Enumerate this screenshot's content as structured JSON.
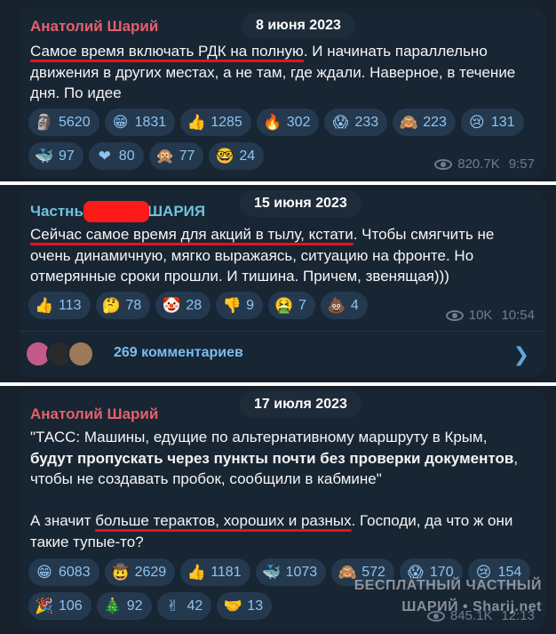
{
  "posts": [
    {
      "author": "Анатолий Шарий",
      "date": "8 июня 2023",
      "text_underlined": "Самое время включать РДК на полную",
      "text_rest": ". И начинать параллельно движения в других местах, а не там, где ждали. Наверное, в течение дня. По идее",
      "reactions": [
        {
          "icon": "moai-icon",
          "glyph": "🗿",
          "count": "5620"
        },
        {
          "icon": "grin-icon",
          "glyph": "😁",
          "count": "1831"
        },
        {
          "icon": "thumbs-up-icon",
          "glyph": "👍",
          "count": "1285"
        },
        {
          "icon": "fire-icon",
          "glyph": "🔥",
          "count": "302"
        },
        {
          "icon": "scream-icon",
          "glyph": "😱",
          "count": "233"
        },
        {
          "icon": "see-no-evil-monkey-icon",
          "glyph": "🙈",
          "count": "223"
        },
        {
          "icon": "crying-face-icon",
          "glyph": "😢",
          "count": "131"
        },
        {
          "icon": "whale-icon",
          "glyph": "🐳",
          "count": "97"
        },
        {
          "icon": "red-heart-icon",
          "glyph": "❤",
          "count": "80"
        },
        {
          "icon": "monkey-icon",
          "glyph": "🙊",
          "count": "77"
        },
        {
          "icon": "nerd-face-icon",
          "glyph": "🤓",
          "count": "24"
        }
      ],
      "views": "820.7K",
      "time": "9:57"
    },
    {
      "author_left": "Частны",
      "author_right": "ШАРИЯ",
      "date": "15 июня 2023",
      "text_underlined": "Сейчас самое время для акций в тылу, кстати",
      "text_rest": ". Чтобы смягчить не очень динамичную, мягко выражаясь, ситуацию на фронте. Но отмерянные сроки прошли. И тишина. Причем, звенящая)))",
      "reactions": [
        {
          "icon": "thumbs-up-icon",
          "glyph": "👍",
          "count": "113"
        },
        {
          "icon": "thinking-face-icon",
          "glyph": "🤔",
          "count": "78"
        },
        {
          "icon": "clown-face-icon",
          "glyph": "🤡",
          "count": "28"
        },
        {
          "icon": "thumbs-down-icon",
          "glyph": "👎",
          "count": "9"
        },
        {
          "icon": "nauseated-face-icon",
          "glyph": "🤮",
          "count": "7"
        },
        {
          "icon": "poop-icon",
          "glyph": "💩",
          "count": "4"
        }
      ],
      "views": "10K",
      "time": "10:54",
      "comments_label": "269 комментариев"
    },
    {
      "author": "Анатолий Шарий",
      "date": "17 июля 2023",
      "text_quote_1": "\"ТАСС: Машины, едущие по альтернативному маршруту в Крым, ",
      "text_quote_bold": "будут пропускать через пункты почти без проверки документов",
      "text_quote_2": ", чтобы не создавать пробок, сообщили в кабмине\"",
      "text_p2_1": "А значит ",
      "text_p2_underlined": "больше терактов, хороших и разных",
      "text_p2_2": ". Господи, да что ж они такие тупые-то?",
      "reactions": [
        {
          "icon": "grin-icon",
          "glyph": "😁",
          "count": "6083"
        },
        {
          "icon": "cowboy-face-icon",
          "glyph": "🤠",
          "count": "2629"
        },
        {
          "icon": "thumbs-up-icon",
          "glyph": "👍",
          "count": "1181"
        },
        {
          "icon": "whale-icon",
          "glyph": "🐳",
          "count": "1073"
        },
        {
          "icon": "see-no-evil-monkey-icon",
          "glyph": "🙈",
          "count": "572"
        },
        {
          "icon": "scream-icon",
          "glyph": "😱",
          "count": "170"
        },
        {
          "icon": "crying-face-icon",
          "glyph": "😢",
          "count": "154"
        },
        {
          "icon": "party-popper-icon",
          "glyph": "🎉",
          "count": "106"
        },
        {
          "icon": "christmas-tree-icon",
          "glyph": "🎄",
          "count": "92"
        },
        {
          "icon": "victory-hand-icon",
          "glyph": "✌",
          "count": "42"
        },
        {
          "icon": "handshake-icon",
          "glyph": "🤝",
          "count": "13"
        }
      ],
      "views": "845.1K",
      "time": "12:13"
    }
  ],
  "watermark": {
    "line1": "БЕСПЛАТНЫЙ ЧАСТНЫЙ",
    "line2": "ШАРИЙ • Sharij.net"
  }
}
